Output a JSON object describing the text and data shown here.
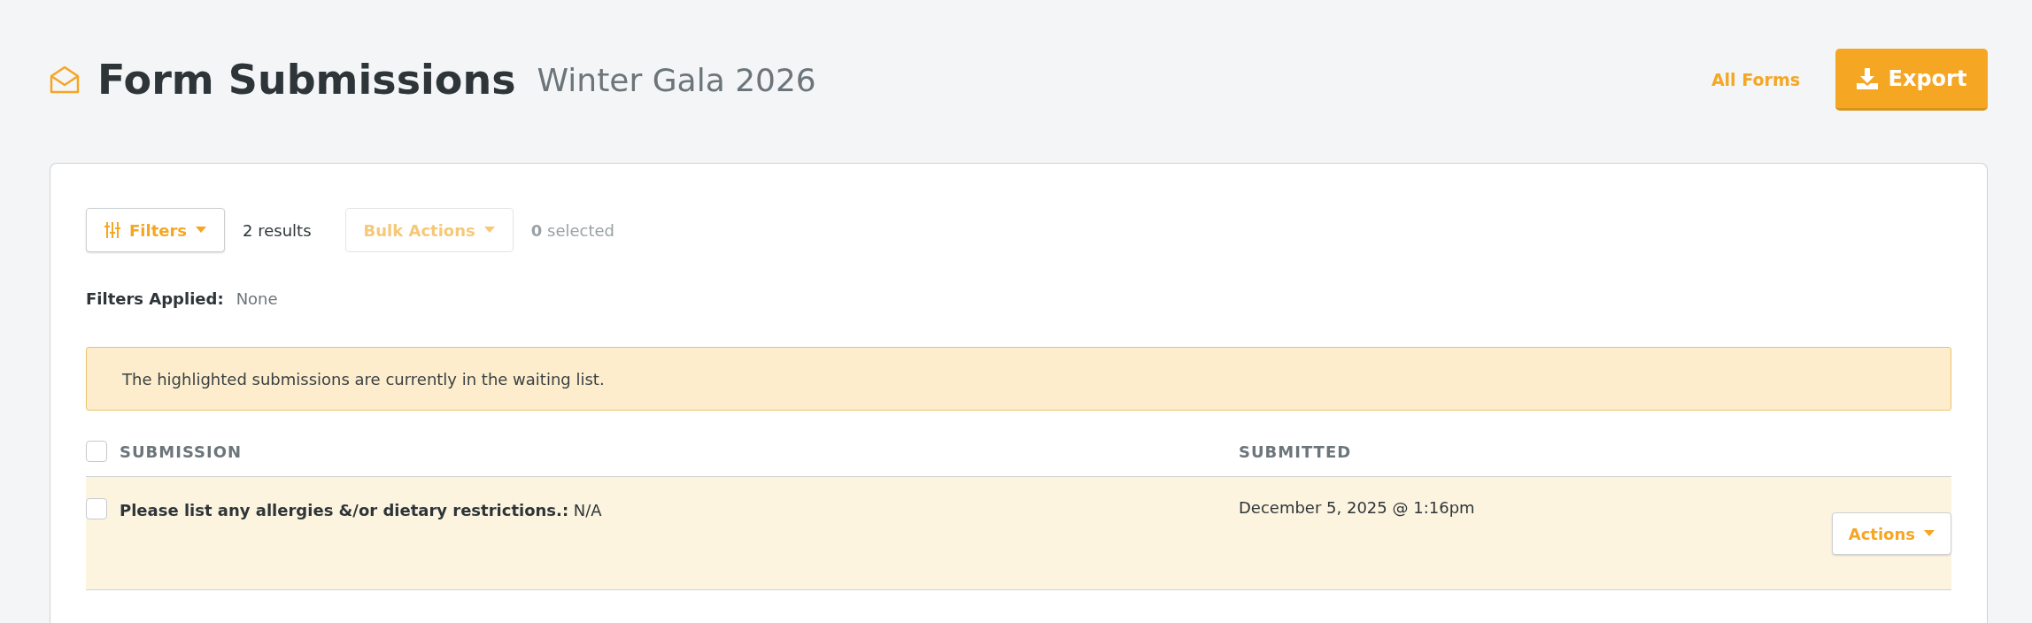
{
  "header": {
    "title": "Form Submissions",
    "subtitle": "Winter Gala 2026",
    "link": "All Forms",
    "export_button": "Export"
  },
  "toolbar": {
    "filters_button": "Filters",
    "results": "2 results",
    "bulk_actions": {
      "label": "Bulk Actions",
      "disabled": true
    },
    "selected_count": "0",
    "selected_label": "selected"
  },
  "filters_applied": {
    "label": "Filters Applied:",
    "value": "None"
  },
  "alert": "The highlighted submissions are currently in the waiting list.",
  "table": {
    "select_all_checked": false,
    "columns": [
      "SUBMISSION",
      "SUBMITTED"
    ],
    "rows": [
      {
        "submission": "**Please list any allergies &/or dietary restrictions.:** N/A",
        "submitted": "December 5, 2025 @ 1:16pm",
        "waitlisted": true,
        "checked": false,
        "actions": "Actions"
      }
    ]
  }
}
